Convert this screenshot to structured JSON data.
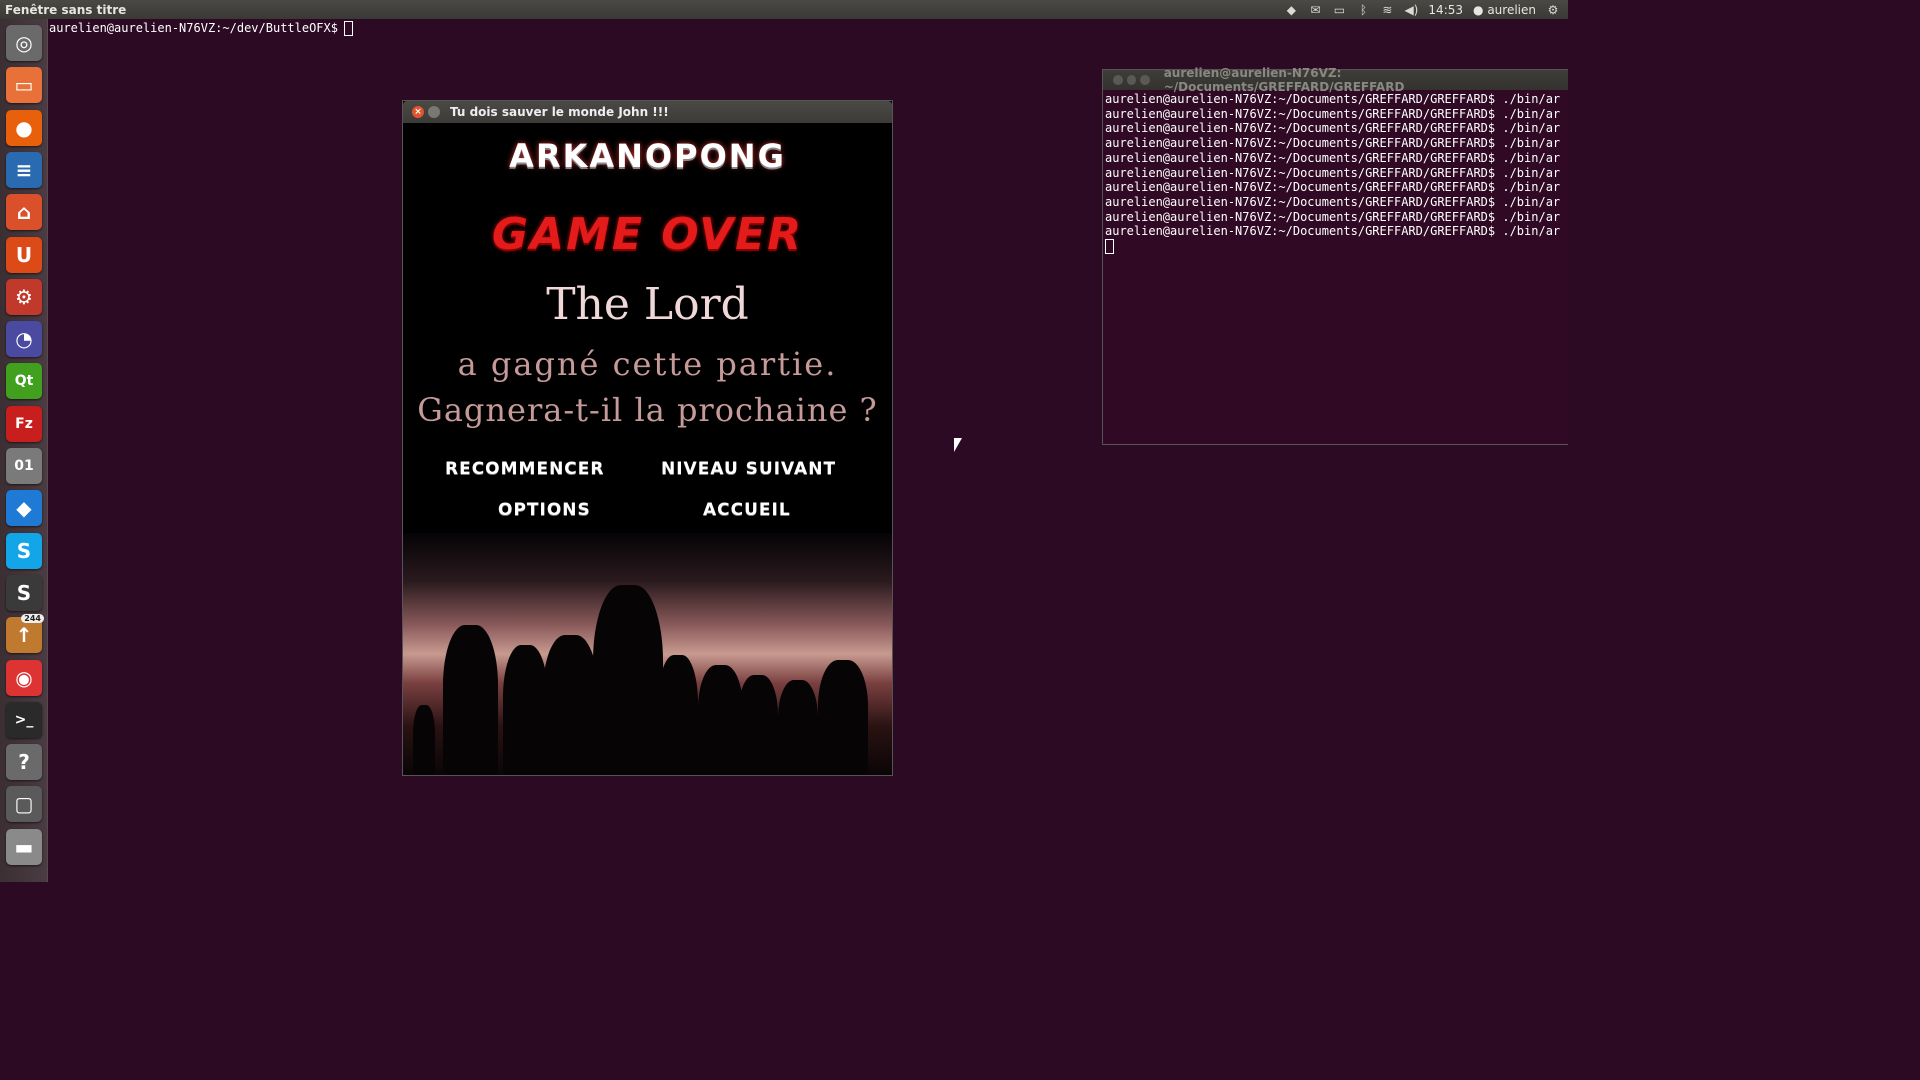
{
  "top_panel": {
    "title": "Fenêtre sans titre",
    "time": "14:53",
    "user": "aurelien",
    "icons": [
      "dropbox-icon",
      "mail-icon",
      "battery-icon",
      "bluetooth-icon",
      "wifi-icon",
      "volume-icon",
      "user-icon",
      "gear-icon"
    ]
  },
  "launcher": {
    "items": [
      {
        "name": "dash-home-icon",
        "glyph": "◎",
        "color": "#6a6a6a"
      },
      {
        "name": "files-icon",
        "glyph": "▭",
        "color": "#e8713a"
      },
      {
        "name": "firefox-icon",
        "glyph": "●",
        "color": "#e8600c"
      },
      {
        "name": "writer-icon",
        "glyph": "≡",
        "color": "#2a6ab0"
      },
      {
        "name": "software-center-icon",
        "glyph": "⌂",
        "color": "#d9502a"
      },
      {
        "name": "ubuntu-one-icon",
        "glyph": "U",
        "color": "#dc4a18"
      },
      {
        "name": "system-settings-icon",
        "glyph": "⚙",
        "color": "#c0392b"
      },
      {
        "name": "disk-usage-icon",
        "glyph": "◔",
        "color": "#4a4aa0"
      },
      {
        "name": "qt-creator-icon",
        "glyph": "Qt",
        "color": "#41a01e"
      },
      {
        "name": "filezilla-icon",
        "glyph": "Fz",
        "color": "#c81e1e"
      },
      {
        "name": "binary-icon",
        "glyph": "01",
        "color": "#7a7a7a"
      },
      {
        "name": "dropbox-icon",
        "glyph": "◆",
        "color": "#1f7ad6"
      },
      {
        "name": "skype-icon",
        "glyph": "S",
        "color": "#12a5e8"
      },
      {
        "name": "sublime-icon",
        "glyph": "S",
        "color": "#3a3a3a"
      },
      {
        "name": "update-manager-icon",
        "glyph": "↑",
        "color": "#c07a30",
        "badge": "244"
      },
      {
        "name": "chrome-icon",
        "glyph": "◉",
        "color": "#d33"
      },
      {
        "name": "terminal-icon",
        "glyph": ">_",
        "color": "#2a2a2a"
      },
      {
        "name": "help-icon",
        "glyph": "?",
        "color": "#6a6a6a"
      },
      {
        "name": "workspace-icon",
        "glyph": "▢",
        "color": "#5a5a5a"
      },
      {
        "name": "drive-icon",
        "glyph": "▬",
        "color": "#8a8a8a"
      }
    ]
  },
  "bg_terminal": {
    "prompt": "aurelien@aurelien-N76VZ:~/dev/ButtleOFX$"
  },
  "game_window": {
    "title": "Tu dois sauver le monde John !!!",
    "logo": "ARKANOPONG",
    "game_over": "GAME OVER",
    "winner": "The Lord",
    "line1": "a gagné cette partie.",
    "line2": "Gagnera-t-il la prochaine ?",
    "buttons": {
      "restart": "RECOMMENCER",
      "next": "NIVEAU SUIVANT",
      "options": "OPTIONS",
      "home": "ACCUEIL"
    }
  },
  "right_terminal": {
    "title": "aurelien@aurelien-N76VZ: ~/Documents/GREFFARD/GREFFARD",
    "lines": [
      "aurelien@aurelien-N76VZ:~/Documents/GREFFARD/GREFFARD$ ./bin/ar",
      "aurelien@aurelien-N76VZ:~/Documents/GREFFARD/GREFFARD$ ./bin/ar",
      "aurelien@aurelien-N76VZ:~/Documents/GREFFARD/GREFFARD$ ./bin/ar",
      "aurelien@aurelien-N76VZ:~/Documents/GREFFARD/GREFFARD$ ./bin/ar",
      "aurelien@aurelien-N76VZ:~/Documents/GREFFARD/GREFFARD$ ./bin/ar",
      "aurelien@aurelien-N76VZ:~/Documents/GREFFARD/GREFFARD$ ./bin/ar",
      "aurelien@aurelien-N76VZ:~/Documents/GREFFARD/GREFFARD$ ./bin/ar",
      "aurelien@aurelien-N76VZ:~/Documents/GREFFARD/GREFFARD$ ./bin/ar",
      "aurelien@aurelien-N76VZ:~/Documents/GREFFARD/GREFFARD$ ./bin/ar",
      "aurelien@aurelien-N76VZ:~/Documents/GREFFARD/GREFFARD$ ./bin/ar"
    ]
  }
}
